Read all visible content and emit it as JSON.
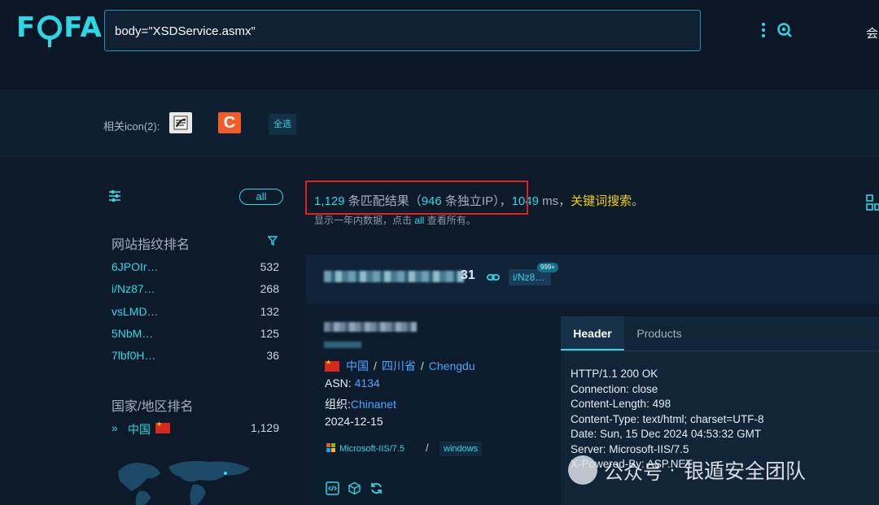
{
  "brand": {
    "logo_text": "FOFA",
    "accent": "#2ad8e6"
  },
  "search": {
    "query": "body=\"XSDService.asmx\""
  },
  "topright": {
    "label": "会"
  },
  "related_icons": {
    "label": "相关icon(2):",
    "icon2_glyph": "C",
    "select_all": "全选"
  },
  "sidebar": {
    "all_label": "all",
    "fingerprint_title": "网站指纹排名",
    "fingerprints": [
      {
        "key": "6JPOIr…",
        "count": "532"
      },
      {
        "key": "i/Nz87…",
        "count": "268"
      },
      {
        "key": "vsLMD…",
        "count": "132"
      },
      {
        "key": "5NbM…",
        "count": "125"
      },
      {
        "key": "7lbf0H…",
        "count": "36"
      }
    ],
    "country_title": "国家/地区排名",
    "country": {
      "chevron": "»",
      "name": "中国",
      "count": "1,129"
    }
  },
  "stats": {
    "count": "1,129",
    "count_suffix": " 条匹配结果（",
    "ip_count": "946",
    "ip_suffix": " 条独立IP），",
    "ms": "1049",
    "ms_suffix": " ms，",
    "keyword_search": "关键词搜索",
    "end": "。",
    "sub_prefix": "显示一年内数据，点击 ",
    "sub_all": "all",
    "sub_suffix": " 查看所有。"
  },
  "result": {
    "head_tail": "31",
    "fingerprint_tag": "i/Nz8…",
    "badge": "999+",
    "location": {
      "country": "中国",
      "province": "四川省",
      "city": "Chengdu",
      "sep": "/"
    },
    "asn_label": "ASN:",
    "asn": "4134",
    "org_label": "组织:",
    "org": "Chinanet",
    "date": "2024-12-15",
    "tech1": "Microsoft-IIS/7.5",
    "tech_sep": "/",
    "tech2": "windows",
    "tabs": {
      "header": "Header",
      "products": "Products"
    },
    "header_lines": [
      "HTTP/1.1 200 OK",
      "Connection: close",
      "Content-Length: 498",
      "Content-Type: text/html; charset=UTF-8",
      "Date: Sun, 15 Dec 2024 04:53:32 GMT",
      "Server: Microsoft-IIS/7.5",
      "X-Powered-By: ASP.NET"
    ]
  },
  "watermark": {
    "text1": "公众号",
    "dot": "·",
    "text2": "银遁安全团队"
  }
}
